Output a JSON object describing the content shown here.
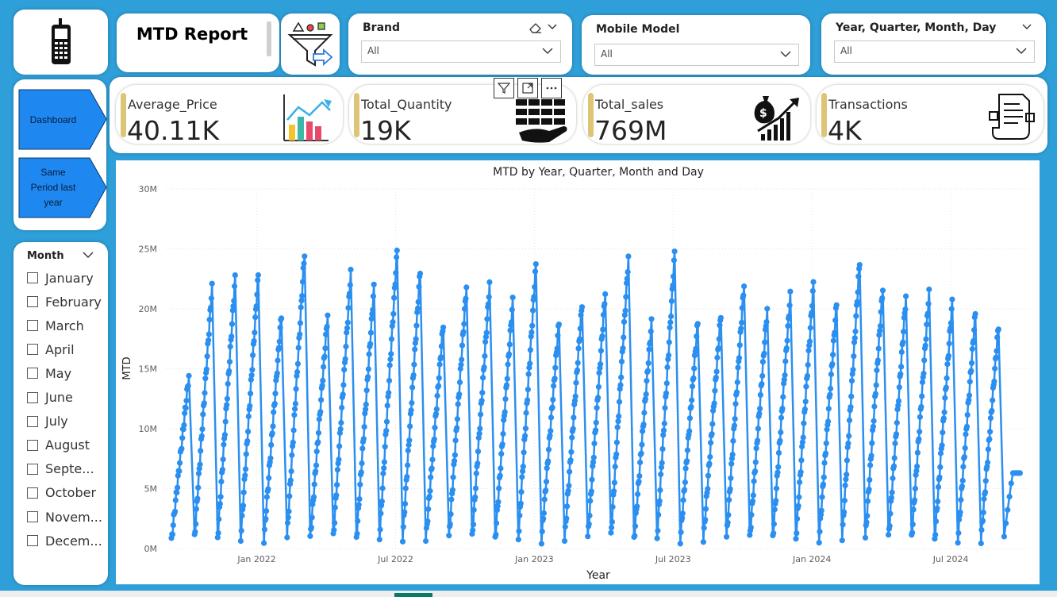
{
  "header": {
    "report_title": "MTD Report",
    "phone_icon": "mobile-phone-icon",
    "filter_icon": "filter-funnel-icon"
  },
  "slicers": {
    "brand": {
      "title": "Brand",
      "value": "All",
      "icon": "eraser-icon"
    },
    "model": {
      "title": "Mobile Model",
      "value": "All"
    },
    "date": {
      "title": "Year, Quarter, Month, Day",
      "value": "All"
    }
  },
  "nav": {
    "dashboard": "Dashboard",
    "same_period_lines": [
      "Same",
      "Period last",
      "year"
    ]
  },
  "kpis": [
    {
      "label": "Average_Price",
      "value": "40.11K",
      "icon": "bar-chart-icon"
    },
    {
      "label": "Total_Quantity",
      "value": "19K",
      "icon": "hand-boxes-icon"
    },
    {
      "label": "Total_sales",
      "value": "769M",
      "icon": "money-growth-icon"
    },
    {
      "label": "Transactions",
      "value": "4K",
      "icon": "receipt-icon"
    }
  ],
  "month_slicer": {
    "title": "Month",
    "items": [
      "January",
      "February",
      "March",
      "April",
      "May",
      "June",
      "July",
      "August",
      "Septe...",
      "October",
      "Novem...",
      "Decem..."
    ]
  },
  "colors": {
    "accent": "#2b8ff0",
    "frame": "#2e9fd8",
    "kpi_bar": "#dcc576"
  },
  "chart_data": {
    "type": "line",
    "title": "MTD by Year, Quarter, Month and Day",
    "xlabel": "Year",
    "ylabel": "MTD",
    "y_tick_labels": [
      "0M",
      "5M",
      "10M",
      "15M",
      "20M",
      "25M",
      "30M"
    ],
    "x_tick_labels": [
      "Jan 2022",
      "Jul 2022",
      "Jan 2023",
      "Jul 2023",
      "Jan 2024",
      "Jul 2024"
    ],
    "ylim": [
      0,
      30
    ],
    "y_unit": "M",
    "grid": true,
    "x_range": [
      "2021-09",
      "2024-10"
    ],
    "series": [
      {
        "values_in_millions_month_end": [
          14.4,
          21.8,
          22.5,
          22.8,
          19.5,
          24.7,
          19.5,
          23.0,
          21.7,
          24.8,
          23.2,
          18.8,
          21.9,
          22.0,
          20.6,
          23.6,
          18.9,
          20.5,
          21.4,
          24.2,
          18.8,
          24.6,
          18.9,
          19.6,
          22.1,
          19.9,
          21.1,
          22.0,
          20.4,
          24.0,
          21.8,
          21.0,
          21.3,
          20.5,
          19.6,
          18.6,
          6.3
        ]
      }
    ]
  }
}
